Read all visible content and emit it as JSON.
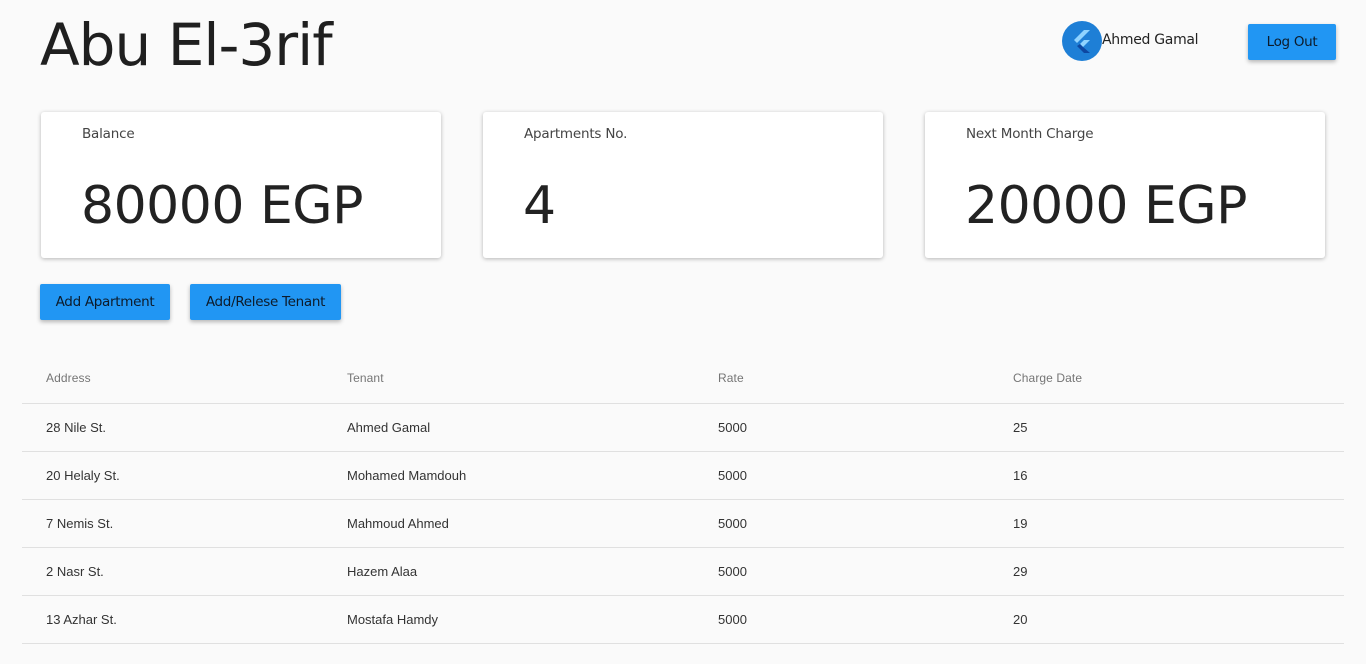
{
  "header": {
    "title": "Abu El-3rif",
    "user_name": "Ahmed Gamal",
    "avatar_icon": "flutter-logo-icon",
    "logout_label": "Log Out"
  },
  "cards": [
    {
      "label": "Balance",
      "value": "80000 EGP"
    },
    {
      "label": "Apartments No.",
      "value": "4"
    },
    {
      "label": "Next Month Charge",
      "value": "20000 EGP"
    }
  ],
  "actions": {
    "add_apartment_label": "Add Apartment",
    "add_tenant_label": "Add/Relese Tenant"
  },
  "table": {
    "columns": [
      "Address",
      "Tenant",
      "Rate",
      "Charge Date"
    ],
    "rows": [
      [
        "28 Nile St.",
        "Ahmed Gamal",
        "5000",
        "25"
      ],
      [
        "20 Helaly St.",
        "Mohamed Mamdouh",
        "5000",
        "16"
      ],
      [
        "7 Nemis St.",
        "Mahmoud Ahmed",
        "5000",
        "19"
      ],
      [
        "2 Nasr St.",
        "Hazem Alaa",
        "5000",
        "29"
      ],
      [
        "13 Azhar St.",
        "Mostafa Hamdy",
        "5000",
        "20"
      ]
    ]
  },
  "colors": {
    "accent": "#2196f3",
    "avatar_bg": "#1e7fd6",
    "background": "#fafafa"
  }
}
